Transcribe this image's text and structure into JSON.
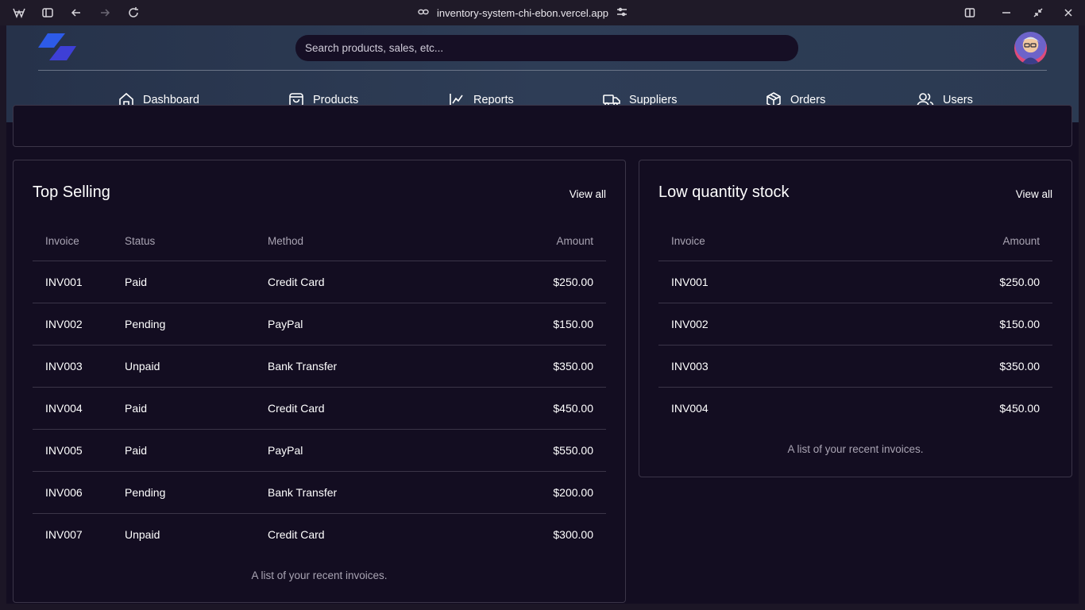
{
  "browser": {
    "url": "inventory-system-chi-ebon.vercel.app"
  },
  "header": {
    "search_placeholder": "Search products, sales, etc...",
    "nav": [
      {
        "label": "Dashboard",
        "icon": "home-icon"
      },
      {
        "label": "Products",
        "icon": "shopping-bag-icon"
      },
      {
        "label": "Reports",
        "icon": "chart-icon"
      },
      {
        "label": "Suppliers",
        "icon": "truck-icon"
      },
      {
        "label": "Orders",
        "icon": "package-icon"
      },
      {
        "label": "Users",
        "icon": "users-icon"
      }
    ]
  },
  "top_selling": {
    "title": "Top Selling",
    "view_all": "View all",
    "columns": [
      "Invoice",
      "Status",
      "Method",
      "Amount"
    ],
    "rows": [
      {
        "invoice": "INV001",
        "status": "Paid",
        "method": "Credit Card",
        "amount": "$250.00"
      },
      {
        "invoice": "INV002",
        "status": "Pending",
        "method": "PayPal",
        "amount": "$150.00"
      },
      {
        "invoice": "INV003",
        "status": "Unpaid",
        "method": "Bank Transfer",
        "amount": "$350.00"
      },
      {
        "invoice": "INV004",
        "status": "Paid",
        "method": "Credit Card",
        "amount": "$450.00"
      },
      {
        "invoice": "INV005",
        "status": "Paid",
        "method": "PayPal",
        "amount": "$550.00"
      },
      {
        "invoice": "INV006",
        "status": "Pending",
        "method": "Bank Transfer",
        "amount": "$200.00"
      },
      {
        "invoice": "INV007",
        "status": "Unpaid",
        "method": "Credit Card",
        "amount": "$300.00"
      }
    ],
    "caption": "A list of your recent invoices."
  },
  "low_stock": {
    "title": "Low quantity stock",
    "view_all": "View all",
    "columns": [
      "Invoice",
      "Amount"
    ],
    "rows": [
      {
        "invoice": "INV001",
        "amount": "$250.00"
      },
      {
        "invoice": "INV002",
        "amount": "$150.00"
      },
      {
        "invoice": "INV003",
        "amount": "$350.00"
      },
      {
        "invoice": "INV004",
        "amount": "$450.00"
      }
    ],
    "caption": "A list of your recent invoices."
  },
  "colors": {
    "background": "#130d21",
    "header": "#2b3a52",
    "logo": "#2d5be8",
    "border": "#3b3548"
  }
}
